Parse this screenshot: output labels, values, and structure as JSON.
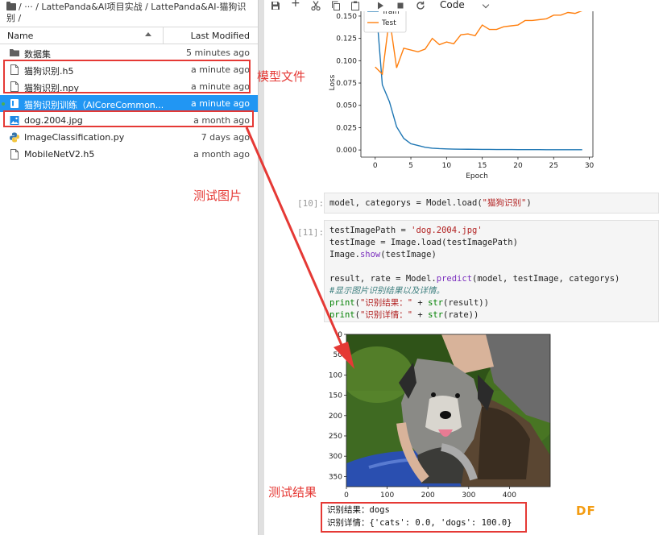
{
  "breadcrumb": {
    "line1": "/ ··· / LattePanda&AI项目实战 / LattePanda&AI-猫狗识",
    "line2": "别 /"
  },
  "file_list": {
    "col_name": "Name",
    "col_modified": "Last Modified",
    "rows": [
      {
        "name": "数据集",
        "modified": "5 minutes ago",
        "icon": "folder-icon"
      },
      {
        "name": "猫狗识别.h5",
        "modified": "a minute ago",
        "icon": "file-icon"
      },
      {
        "name": "猫狗识别.npy",
        "modified": "a minute ago",
        "icon": "file-icon"
      },
      {
        "name": "猫狗识别训练（AICoreCommon...",
        "modified": "a minute ago",
        "icon": "notebook-icon"
      },
      {
        "name": "dog.2004.jpg",
        "modified": "a month ago",
        "icon": "image-icon"
      },
      {
        "name": "ImageClassification.py",
        "modified": "7 days ago",
        "icon": "python-icon"
      },
      {
        "name": "MobileNetV2.h5",
        "modified": "a month ago",
        "icon": "file-icon"
      }
    ]
  },
  "toolbar": {
    "kernel_mode": "Code"
  },
  "cells": {
    "c10": {
      "prompt": "[10]:",
      "line1": [
        "model, categorys = Model.load(",
        "\"猫狗识别\"",
        ")"
      ]
    },
    "c11": {
      "prompt": "[11]:",
      "l1": [
        "testImagePath = ",
        "'dog.2004.jpg'"
      ],
      "l2": [
        "testImage = Image.load(testImagePath)"
      ],
      "l3": [
        "Image.",
        "show",
        "(testImage)"
      ],
      "l5": [
        "result, rate = Model.",
        "predict",
        "(model, testImage, categorys)"
      ],
      "l6": [
        "#显示图片识别结果以及详情。"
      ],
      "l7": [
        "print",
        "(",
        "\"识别结果：\"",
        " + ",
        "str",
        "(result))"
      ],
      "l8": [
        "print",
        "(",
        "\"识别详情：\"",
        " + ",
        "str",
        "(rate))"
      ]
    }
  },
  "output": {
    "result_line": "识别结果：dogs",
    "detail_line": "识别详情：{'cats': 0.0, 'dogs': 100.0}"
  },
  "annotations": {
    "model_files": "模型文件",
    "test_image": "测试图片",
    "test_result": "测试结果"
  },
  "watermark": "DF",
  "colors": {
    "selection": "#2196f3",
    "annotation": "#e53935",
    "train_line": "#1f77b4",
    "test_line": "#ff7f0e",
    "watermark": "#f39c12"
  },
  "chart_data": [
    {
      "type": "line",
      "xlabel": "Epoch",
      "ylabel": "Loss",
      "xlim": [
        -2,
        30.5
      ],
      "ylim": [
        -0.008,
        0.168
      ],
      "xticks": [
        0,
        5,
        10,
        15,
        20,
        25,
        30
      ],
      "yticks": [
        0.0,
        0.025,
        0.05,
        0.075,
        0.1,
        0.125,
        0.15
      ],
      "legend_position": "top-left",
      "series": [
        {
          "name": "Train",
          "color": "#1f77b4",
          "x": [
            0,
            1,
            2,
            3,
            4,
            5,
            6,
            7,
            8,
            9,
            10,
            11,
            12,
            13,
            14,
            15,
            16,
            17,
            18,
            19,
            20,
            21,
            22,
            23,
            24,
            25,
            26,
            27,
            28,
            29
          ],
          "y": [
            0.175,
            0.073,
            0.054,
            0.026,
            0.013,
            0.007,
            0.005,
            0.003,
            0.002,
            0.0015,
            0.0012,
            0.001,
            0.0009,
            0.0008,
            0.0007,
            0.0006,
            0.0006,
            0.0005,
            0.0005,
            0.0005,
            0.0004,
            0.0004,
            0.0004,
            0.0004,
            0.0003,
            0.0003,
            0.0003,
            0.0003,
            0.0003,
            0.0003
          ]
        },
        {
          "name": "Test",
          "color": "#ff7f0e",
          "x": [
            0,
            1,
            2,
            3,
            4,
            5,
            6,
            7,
            8,
            9,
            10,
            11,
            12,
            13,
            14,
            15,
            16,
            17,
            18,
            19,
            20,
            21,
            22,
            23,
            24,
            25,
            26,
            27,
            28,
            29
          ],
          "y": [
            0.093,
            0.085,
            0.148,
            0.092,
            0.114,
            0.112,
            0.11,
            0.113,
            0.125,
            0.118,
            0.121,
            0.119,
            0.129,
            0.13,
            0.128,
            0.14,
            0.135,
            0.135,
            0.138,
            0.139,
            0.14,
            0.145,
            0.145,
            0.146,
            0.147,
            0.151,
            0.151,
            0.154,
            0.153,
            0.156
          ]
        }
      ]
    },
    {
      "type": "image",
      "xticks": [
        0,
        100,
        200,
        300,
        400
      ],
      "yticks": [
        0,
        50,
        100,
        150,
        200,
        250,
        300,
        350
      ],
      "xlim": [
        0,
        500
      ],
      "ylim": [
        0,
        375
      ]
    }
  ]
}
